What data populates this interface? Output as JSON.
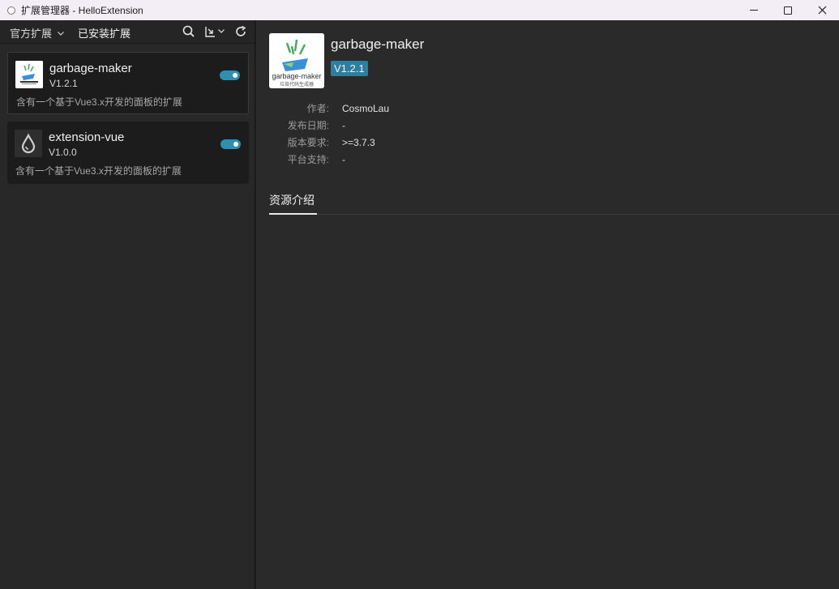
{
  "window": {
    "title": "扩展管理器 - HelloExtension"
  },
  "toolbar": {
    "tab_official": "官方扩展",
    "tab_installed": "已安装扩展",
    "icons": [
      "search-icon",
      "download-icon",
      "chevron-down-icon",
      "refresh-icon"
    ]
  },
  "extensions": [
    {
      "name": "garbage-maker",
      "version": "V1.2.1",
      "description": "含有一个基于Vue3.x开发的面板的扩展",
      "enabled": true
    },
    {
      "name": "extension-vue",
      "version": "V1.0.0",
      "description": "含有一个基于Vue3.x开发的面板的扩展",
      "enabled": true
    }
  ],
  "detail": {
    "name": "garbage-maker",
    "version": "V1.2.1",
    "logo_text": "garbage-maker",
    "logo_subtext": "垃圾代码生成器",
    "meta": [
      {
        "label": "作者:",
        "value": "CosmoLau"
      },
      {
        "label": "发布日期:",
        "value": "-"
      },
      {
        "label": "版本要求:",
        "value": ">=3.7.3"
      },
      {
        "label": "平台支持:",
        "value": "-"
      }
    ],
    "tab_intro": "资源介绍"
  },
  "colors": {
    "accent": "#2d7fa2",
    "toggle_on": "#2f8fb3",
    "panel_bg": "#2a2a2a",
    "card_bg": "#1c1c1c"
  }
}
